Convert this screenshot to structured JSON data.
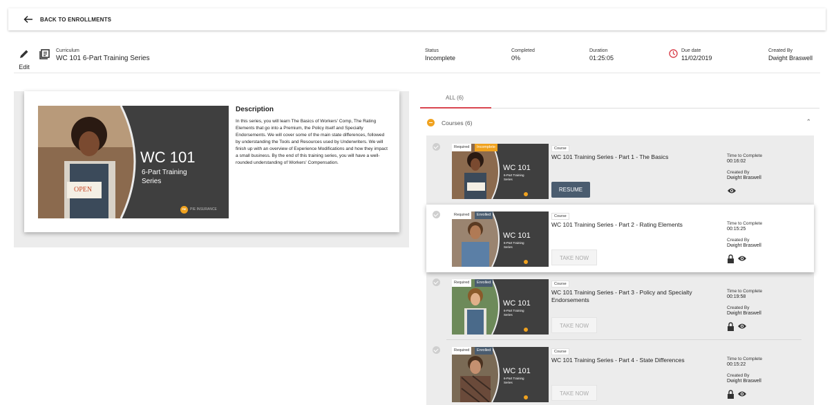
{
  "nav": {
    "back_label": "BACK TO ENROLLMENTS"
  },
  "header": {
    "edit_label": "Edit",
    "type_label": "Curriculum",
    "title": "WC 101 6-Part Training Series",
    "status_label": "Status",
    "status_value": "Incomplete",
    "completed_label": "Completed",
    "completed_value": "0%",
    "duration_label": "Duration",
    "duration_value": "01:25:05",
    "due_label": "Due date",
    "due_value": "11/02/2019",
    "created_label": "Created By",
    "created_value": "Dwight Braswell"
  },
  "thumbnail": {
    "title_main": "WC 101",
    "title_sub": "6-Part Training",
    "title_sub2": "Series",
    "sign_text": "OPEN",
    "brand": "PIE INSURANCE",
    "brand_mark": "PIE"
  },
  "description": {
    "title": "Description",
    "body": "In this series, you will learn The Basics of Workers' Comp, The Rating Elements that go into a Premium, the Policy itself and Specialty Endorsements. We will cover some of the main state differences, followed by understanding the Tools and Resources used by Underwriters. We will finish up with an overview of Experience Modifications and how they impact a small business. By the end of this training series, you will have a well-rounded understanding of Workers' Compensation."
  },
  "tabs": {
    "all_label": "ALL (6)"
  },
  "courses": {
    "heading": "Courses (6)",
    "items": [
      {
        "required": "Required",
        "status": "Incomplete",
        "type": "Course",
        "title": "WC 101 Training Series - Part 1 - The Basics",
        "ttc_label": "Time to Complete",
        "ttc": "00:16:02",
        "created_label": "Created By",
        "created_by": "Dwight Braswell",
        "button": "RESUME"
      },
      {
        "required": "Required",
        "status": "Enrolled",
        "type": "Course",
        "title": "WC 101 Training Series - Part 2 - Rating Elements",
        "ttc_label": "Time to Complete",
        "ttc": "00:15:25",
        "created_label": "Created By",
        "created_by": "Dwight Braswell",
        "button": "TAKE NOW"
      },
      {
        "required": "Required",
        "status": "Enrolled",
        "type": "Course",
        "title": "WC 101 Training Series - Part 3 - Policy and Specialty Endorsements",
        "ttc_label": "Time to Complete",
        "ttc": "00:19:58",
        "created_label": "Created By",
        "created_by": "Dwight Braswell",
        "button": "TAKE NOW"
      },
      {
        "required": "Required",
        "status": "Enrolled",
        "type": "Course",
        "title": "WC 101 Training Series - Part 4 - State Differences",
        "ttc_label": "Time to Complete",
        "ttc": "00:15:22",
        "created_label": "Created By",
        "created_by": "Dwight Braswell",
        "button": "TAKE NOW"
      }
    ]
  },
  "colors": {
    "accent_red": "#d9444f",
    "incomplete": "#f0a21f",
    "enrolled": "#4a5c6f",
    "resume_button": "#4a5c6f",
    "thumb_dark": "#3f3f3f"
  },
  "icons": [
    "arrow-left-icon",
    "pencil-icon",
    "book-icon",
    "clock-icon",
    "check-circle-icon",
    "minus-circle-icon",
    "chevron-up-icon",
    "lock-icon",
    "eye-icon"
  ]
}
